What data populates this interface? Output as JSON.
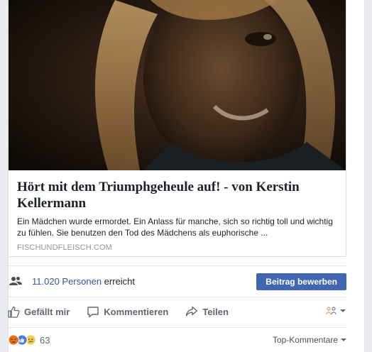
{
  "link_preview": {
    "title": "Hört mit dem Triumphgeheule auf! - von Kerstin Kellermann",
    "description": "Ein Mädchen wurde ermordet. Ein Anlass für manche, sich so richtig toll und wichtig zu fühlen. Sie benutzen den Tod des Mädchens als euphorische ...",
    "domain": "FISCHUNDFLEISCH.COM"
  },
  "reach": {
    "count": "11.020 Personen",
    "suffix": " erreicht",
    "icon": "people-icon",
    "boost_label": "Beitrag bewerben"
  },
  "actions": {
    "like_label": "Gefällt mir",
    "comment_label": "Kommentieren",
    "share_label": "Teilen",
    "share_menu_icon": "audience-selector-icon"
  },
  "reactions": {
    "icons": [
      "angry-icon",
      "like-icon",
      "sad-icon"
    ],
    "count": "63",
    "sort_label": "Top-Kommentare"
  },
  "colors": {
    "link": "#365899",
    "button": "#4267b2",
    "muted": "#90949c"
  }
}
